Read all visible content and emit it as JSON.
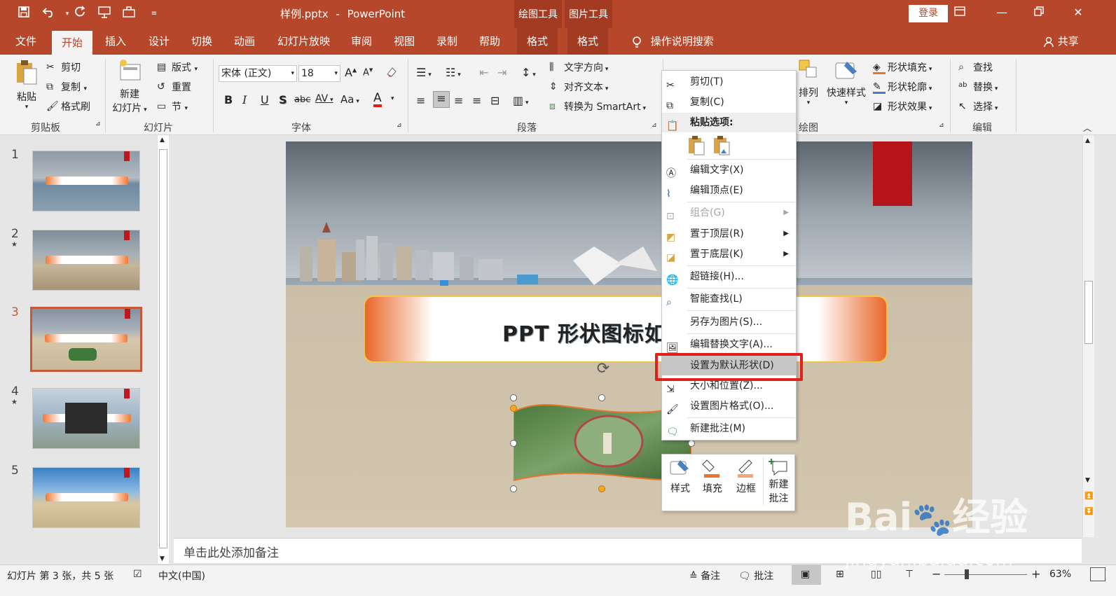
{
  "app": {
    "filename": "样例.pptx",
    "separator": "-",
    "app_name": "PowerPoint",
    "context_tab_drawing": "绘图工具",
    "context_tab_picture": "图片工具",
    "login": "登录",
    "share": "共享",
    "search_hint": "操作说明搜索"
  },
  "tabs": [
    {
      "label": "文件"
    },
    {
      "label": "开始"
    },
    {
      "label": "插入"
    },
    {
      "label": "设计"
    },
    {
      "label": "切换"
    },
    {
      "label": "动画"
    },
    {
      "label": "幻灯片放映"
    },
    {
      "label": "审阅"
    },
    {
      "label": "视图"
    },
    {
      "label": "录制"
    },
    {
      "label": "帮助"
    },
    {
      "label": "格式"
    },
    {
      "label": "格式"
    }
  ],
  "ribbon": {
    "clipboard": {
      "paste": "粘贴",
      "cut": "剪切",
      "copy": "复制",
      "format_painter": "格式刷",
      "label": "剪贴板"
    },
    "slides": {
      "new_slide_1": "新建",
      "new_slide_2": "幻灯片",
      "layout": "版式",
      "reset": "重置",
      "section": "节",
      "label": "幻灯片"
    },
    "font": {
      "font_name": "宋体 (正文)",
      "font_size": "18",
      "label": "字体",
      "bold": "B",
      "italic": "I",
      "underline": "U",
      "shadow": "S",
      "strike": "abc",
      "spacing": "AV",
      "case": "Aa",
      "color": "A",
      "grow": "A",
      "shrink": "A"
    },
    "paragraph": {
      "text_direction": "文字方向",
      "align_text": "对齐文本",
      "smartart": "转换为 SmartArt",
      "label": "段落"
    },
    "drawing": {
      "arrange": "排列",
      "quick_styles": "快速样式",
      "shape_fill": "形状填充",
      "shape_outline": "形状轮廓",
      "shape_effects": "形状效果",
      "label": "绘图"
    },
    "editing": {
      "find": "查找",
      "replace": "替换",
      "select": "选择",
      "label": "编辑"
    }
  },
  "slides_pane": {
    "numbers": [
      "1",
      "2",
      "3",
      "4",
      "5"
    ],
    "selected": "3"
  },
  "slide": {
    "title_text": "PPT 形状图标如何"
  },
  "context_menu": {
    "cut": "剪切(T)",
    "copy": "复制(C)",
    "paste_options": "粘贴选项:",
    "edit_text": "编辑文字(X)",
    "edit_points": "编辑顶点(E)",
    "group": "组合(G)",
    "bring_front": "置于顶层(R)",
    "send_back": "置于底层(K)",
    "hyperlink": "超链接(H)...",
    "smart_lookup": "智能查找(L)",
    "save_as_picture": "另存为图片(S)...",
    "edit_alt_text": "编辑替换文字(A)...",
    "set_default_shape": "设置为默认形状(D)",
    "size_position": "大小和位置(Z)...",
    "format_picture": "设置图片格式(O)...",
    "new_comment": "新建批注(M)"
  },
  "mini_toolbar": {
    "style": "样式",
    "fill": "填充",
    "border": "边框",
    "new_comment_1": "新建",
    "new_comment_2": "批注"
  },
  "notes_placeholder": "单击此处添加备注",
  "status": {
    "slide_info": "幻灯片 第 3 张，共 5 张",
    "language": "中文(中国)",
    "notes": "备注",
    "comments": "批注",
    "zoom": "63%",
    "minus": "−",
    "plus": "+"
  },
  "watermark": {
    "brand": "Bai",
    "brand_suffix": "经验",
    "url": "jingyan.baidu.com"
  },
  "colors": {
    "accent": "#b7472a",
    "highlight_box": "#e0201a"
  }
}
